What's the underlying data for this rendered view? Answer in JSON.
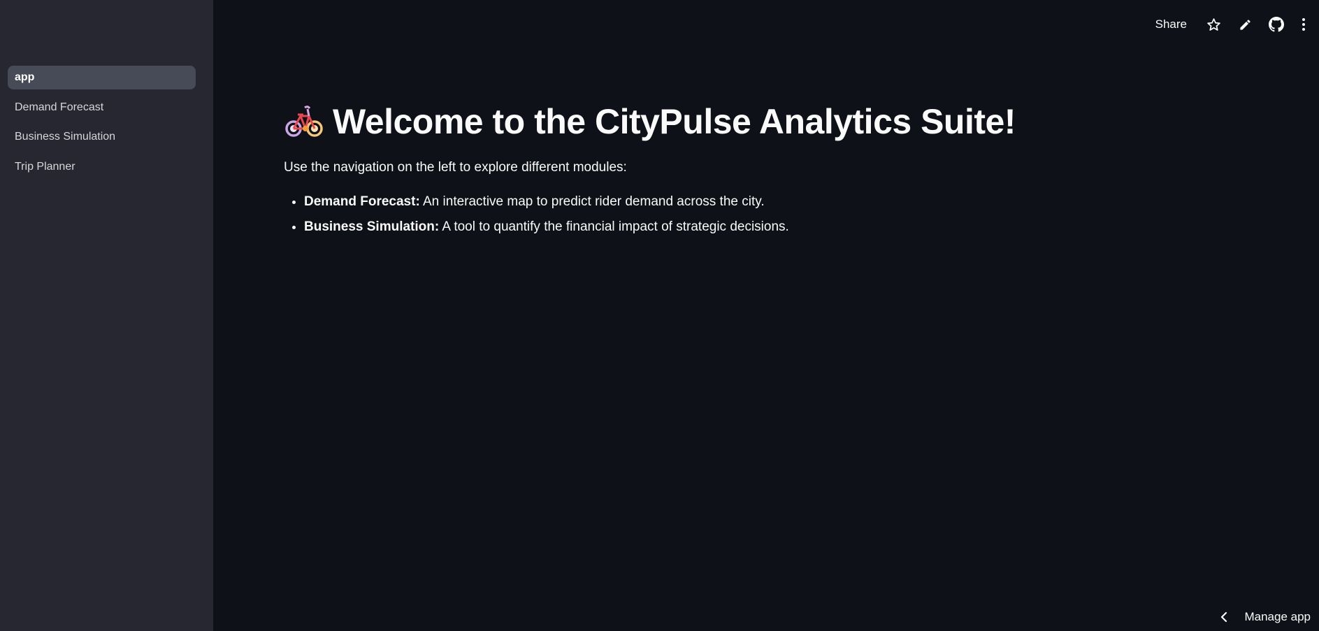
{
  "sidebar": {
    "items": [
      {
        "label": "app",
        "active": true
      },
      {
        "label": "Demand Forecast",
        "active": false
      },
      {
        "label": "Business Simulation",
        "active": false
      },
      {
        "label": "Trip Planner",
        "active": false
      }
    ]
  },
  "toolbar": {
    "share_label": "Share",
    "icons": [
      "star-icon",
      "pencil-icon",
      "github-icon",
      "more-vertical-icon"
    ]
  },
  "main": {
    "title_icon": "bicycle-emoji",
    "title": "Welcome to the CityPulse Analytics Suite!",
    "intro": "Use the navigation on the left to explore different modules:",
    "modules": [
      {
        "name": "Demand Forecast:",
        "description": " An interactive map to predict rider demand across the city."
      },
      {
        "name": "Business Simulation:",
        "description": " A tool to quantify the financial impact of strategic decisions."
      }
    ]
  },
  "footer": {
    "manage_label": "Manage app"
  },
  "colors": {
    "sidebar_bg": "#262730",
    "main_bg": "#0e1117",
    "active_item_bg": "#474b57",
    "text": "#fafafa"
  }
}
